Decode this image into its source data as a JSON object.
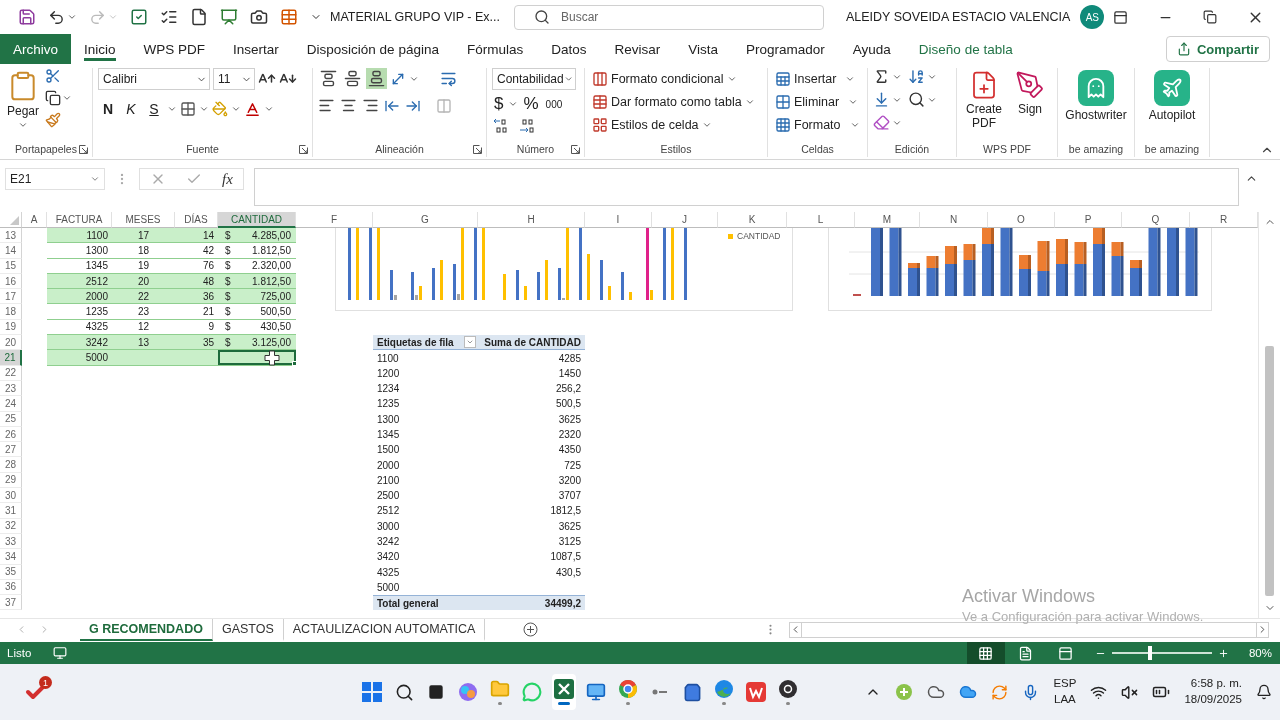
{
  "quick_access": {
    "redo_disabled": true
  },
  "title_bar": {
    "document_title": "MATERIAL GRUPO VIP  -  Ex...",
    "search_placeholder": "Buscar",
    "user_name": "ALEIDY SOVEIDA ESTACIO VALENCIA",
    "avatar_initials": "AS"
  },
  "menu_tabs": [
    {
      "label": "Archivo",
      "kind": "file",
      "selected": false
    },
    {
      "label": "Inicio",
      "kind": "tab",
      "selected": true
    },
    {
      "label": "WPS PDF",
      "kind": "tab",
      "selected": false
    },
    {
      "label": "Insertar",
      "kind": "tab",
      "selected": false
    },
    {
      "label": "Disposición de página",
      "kind": "tab",
      "selected": false
    },
    {
      "label": "Fórmulas",
      "kind": "tab",
      "selected": false
    },
    {
      "label": "Datos",
      "kind": "tab",
      "selected": false
    },
    {
      "label": "Revisar",
      "kind": "tab",
      "selected": false
    },
    {
      "label": "Vista",
      "kind": "tab",
      "selected": false
    },
    {
      "label": "Programador",
      "kind": "tab",
      "selected": false
    },
    {
      "label": "Ayuda",
      "kind": "tab",
      "selected": false
    },
    {
      "label": "Diseño de tabla",
      "kind": "contextual",
      "selected": false
    }
  ],
  "share_button": {
    "label": "Compartir"
  },
  "ribbon": {
    "clipboard": {
      "label": "Portapapeles",
      "paste": "Pegar"
    },
    "font": {
      "label": "Fuente",
      "font_name": "Calibri",
      "font_size": "11",
      "bold": "N",
      "italic": "K",
      "underline": "S"
    },
    "alignment": {
      "label": "Alineación",
      "vertical_align": [
        {
          "selected": false
        },
        {
          "selected": false
        },
        {
          "selected": true
        }
      ],
      "merge_disabled": true
    },
    "number": {
      "label": "Número",
      "format": "Contabilidad",
      "currency": "$",
      "percent": "%",
      "thousands": "000"
    },
    "styles": {
      "label": "Estilos",
      "commands": [
        {
          "label": "Formato condicional"
        },
        {
          "label": "Dar formato como tabla"
        },
        {
          "label": "Estilos de celda"
        }
      ]
    },
    "cells": {
      "label": "Celdas",
      "commands": [
        {
          "label": "Insertar"
        },
        {
          "label": "Eliminar"
        },
        {
          "label": "Formato"
        }
      ]
    },
    "editing": {
      "label": "Edición"
    },
    "wps_pdf": {
      "label": "WPS PDF",
      "commands": [
        {
          "label": "Create PDF"
        },
        {
          "label": "Sign"
        }
      ]
    },
    "addins": [
      {
        "label": "Ghostwriter",
        "group_label": "be amazing"
      },
      {
        "label": "Autopilot",
        "group_label": "be amazing"
      }
    ]
  },
  "formula_bar": {
    "name_box": "E21",
    "function_label": "fx"
  },
  "sheet": {
    "columns": [
      {
        "label": "A",
        "selected": false
      },
      {
        "label": "FACTURA",
        "selected": false
      },
      {
        "label": "MESES",
        "selected": false
      },
      {
        "label": "DÍAS",
        "selected": false
      },
      {
        "label": "CANTIDAD",
        "selected": true
      },
      {
        "label": "F",
        "selected": false
      },
      {
        "label": "G",
        "selected": false
      },
      {
        "label": "H",
        "selected": false
      },
      {
        "label": "I",
        "selected": false
      },
      {
        "label": "J",
        "selected": false
      },
      {
        "label": "K",
        "selected": false
      },
      {
        "label": "L",
        "selected": false
      },
      {
        "label": "M",
        "selected": false
      },
      {
        "label": "N",
        "selected": false
      },
      {
        "label": "O",
        "selected": false
      },
      {
        "label": "P",
        "selected": false
      },
      {
        "label": "Q",
        "selected": false
      },
      {
        "label": "R",
        "selected": false
      }
    ],
    "row_headers": [
      {
        "label": "13",
        "selected": false
      },
      {
        "label": "14",
        "selected": false
      },
      {
        "label": "15",
        "selected": false
      },
      {
        "label": "16",
        "selected": false
      },
      {
        "label": "17",
        "selected": false
      },
      {
        "label": "18",
        "selected": false
      },
      {
        "label": "19",
        "selected": false
      },
      {
        "label": "20",
        "selected": false
      },
      {
        "label": "21",
        "selected": true
      },
      {
        "label": "22",
        "selected": false
      },
      {
        "label": "23",
        "selected": false
      },
      {
        "label": "24",
        "selected": false
      },
      {
        "label": "25",
        "selected": false
      },
      {
        "label": "26",
        "selected": false
      },
      {
        "label": "27",
        "selected": false
      },
      {
        "label": "28",
        "selected": false
      },
      {
        "label": "29",
        "selected": false
      },
      {
        "label": "30",
        "selected": false
      },
      {
        "label": "31",
        "selected": false
      },
      {
        "label": "32",
        "selected": false
      },
      {
        "label": "33",
        "selected": false
      },
      {
        "label": "34",
        "selected": false
      },
      {
        "label": "35",
        "selected": false
      },
      {
        "label": "36",
        "selected": false
      },
      {
        "label": "37",
        "selected": false
      }
    ]
  },
  "sheet_table": {
    "rows": [
      {
        "factura": "1100",
        "meses": "17",
        "dias": "14",
        "currency": "$",
        "cantidad": "4.285,00",
        "highlighted": true,
        "amount_selected": false
      },
      {
        "factura": "1300",
        "meses": "18",
        "dias": "42",
        "currency": "$",
        "cantidad": "1.812,50",
        "highlighted": false,
        "amount_selected": false
      },
      {
        "factura": "1345",
        "meses": "19",
        "dias": "76",
        "currency": "$",
        "cantidad": "2.320,00",
        "highlighted": false,
        "amount_selected": false
      },
      {
        "factura": "2512",
        "meses": "20",
        "dias": "48",
        "currency": "$",
        "cantidad": "1.812,50",
        "highlighted": true,
        "amount_selected": false
      },
      {
        "factura": "2000",
        "meses": "22",
        "dias": "36",
        "currency": "$",
        "cantidad": "725,00",
        "highlighted": true,
        "amount_selected": false
      },
      {
        "factura": "1235",
        "meses": "23",
        "dias": "21",
        "currency": "$",
        "cantidad": "500,50",
        "highlighted": false,
        "amount_selected": false
      },
      {
        "factura": "4325",
        "meses": "12",
        "dias": "9",
        "currency": "$",
        "cantidad": "430,50",
        "highlighted": false,
        "amount_selected": false
      },
      {
        "factura": "3242",
        "meses": "13",
        "dias": "35",
        "currency": "$",
        "cantidad": "3.125,00",
        "highlighted": true,
        "amount_selected": false
      },
      {
        "factura": "5000",
        "highlighted": true,
        "amount_selected": true
      }
    ]
  },
  "pivot_table": {
    "header": {
      "row_label": "Etiquetas de fila",
      "value_label": "Suma de CANTIDAD"
    },
    "rows": [
      {
        "label": "1100",
        "value": "4285"
      },
      {
        "label": "1200",
        "value": "1450"
      },
      {
        "label": "1234",
        "value": "256,2"
      },
      {
        "label": "1235",
        "value": "500,5"
      },
      {
        "label": "1300",
        "value": "3625"
      },
      {
        "label": "1345",
        "value": "2320"
      },
      {
        "label": "1500",
        "value": "4350"
      },
      {
        "label": "2000",
        "value": "725"
      },
      {
        "label": "2100",
        "value": "3200"
      },
      {
        "label": "2500",
        "value": "3707"
      },
      {
        "label": "2512",
        "value": "1812,5"
      },
      {
        "label": "3000",
        "value": "3625"
      },
      {
        "label": "3242",
        "value": "3125"
      },
      {
        "label": "3420",
        "value": "1087,5"
      },
      {
        "label": "4325",
        "value": "430,5"
      },
      {
        "label": "5000"
      }
    ],
    "total": {
      "label": "Total general",
      "value": "34499,2"
    }
  },
  "charts": [
    {
      "legend": "CANTIDAD"
    }
  ],
  "sheet_tabs": [
    {
      "label": "G RECOMENDADO",
      "selected": true
    },
    {
      "label": "GASTOS",
      "selected": false
    },
    {
      "label": "ACTAULIZACION AUTOMATICA",
      "selected": false
    }
  ],
  "activation_notice": {
    "title": "Activar Windows",
    "message": "Ve a Configuración para activar Windows."
  },
  "status_bar": {
    "status": "Listo",
    "zoom_slider": {
      "level": 0.38
    },
    "zoom": "80%"
  },
  "taskbar": {
    "notification_badge": "1",
    "language": "ESP",
    "keyboard_layout": "LAA",
    "time": "6:58 p. m.",
    "date": "18/09/2025"
  }
}
